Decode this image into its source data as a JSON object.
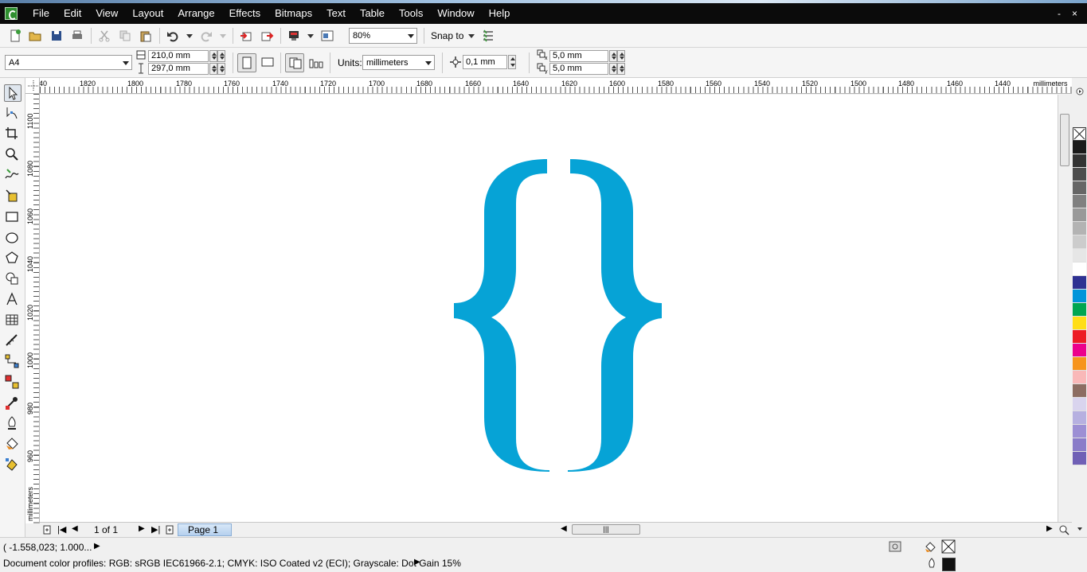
{
  "menubar": {
    "items": [
      {
        "label": "File"
      },
      {
        "label": "Edit"
      },
      {
        "label": "View"
      },
      {
        "label": "Layout"
      },
      {
        "label": "Arrange"
      },
      {
        "label": "Effects"
      },
      {
        "label": "Bitmaps"
      },
      {
        "label": "Text"
      },
      {
        "label": "Table"
      },
      {
        "label": "Tools"
      },
      {
        "label": "Window"
      },
      {
        "label": "Help"
      }
    ],
    "window_controls": [
      "-",
      "×"
    ]
  },
  "standard_toolbar": {
    "zoom_level": "80%",
    "snap_to_label": "Snap to"
  },
  "property_bar": {
    "page_size": "A4",
    "page_width": "210,0 mm",
    "page_height": "297,0 mm",
    "units_label": "Units:",
    "units_value": "millimeters",
    "nudge_distance": "0,1 mm",
    "duplicate_x": "5,0 mm",
    "duplicate_y": "5,0 mm"
  },
  "ruler_top": {
    "labels": [
      "40",
      "1820",
      "1800",
      "1780",
      "1760",
      "1740",
      "1720",
      "1700",
      "1680",
      "1660",
      "1640",
      "1620",
      "1600",
      "1580",
      "1560",
      "1540",
      "1520",
      "1500",
      "1480",
      "1460",
      "1440"
    ],
    "unit": "millimeters"
  },
  "ruler_left": {
    "labels": [
      "1100",
      "1080",
      "1060",
      "1040",
      "1020",
      "1000",
      "980",
      "960"
    ],
    "unit": "millimeters"
  },
  "canvas": {
    "brace_color": "#06a3d6"
  },
  "page_nav": {
    "page_count": "1 of 1",
    "page_tab": "Page 1"
  },
  "palette": {
    "colors": [
      "#1a1a1a",
      "#333333",
      "#4d4d4d",
      "#666666",
      "#808080",
      "#999999",
      "#b3b3b3",
      "#cccccc",
      "#e6e6e6",
      "#ffffff",
      "#2e3192",
      "#0095da",
      "#00a651",
      "#ffde17",
      "#ed1c24",
      "#ec008c",
      "#f7941d",
      "#f9b8b8",
      "#8c6d62",
      "#d9d4ee",
      "#b6b0e0",
      "#9c8fd4",
      "#8a7cc9",
      "#7060b6"
    ]
  },
  "status": {
    "coordinates": "( -1.558,023; 1.000...",
    "color_profiles": "Document color profiles: RGB: sRGB IEC61966-2.1; CMYK: ISO Coated v2 (ECI); Grayscale: Dot Gain 15%"
  }
}
